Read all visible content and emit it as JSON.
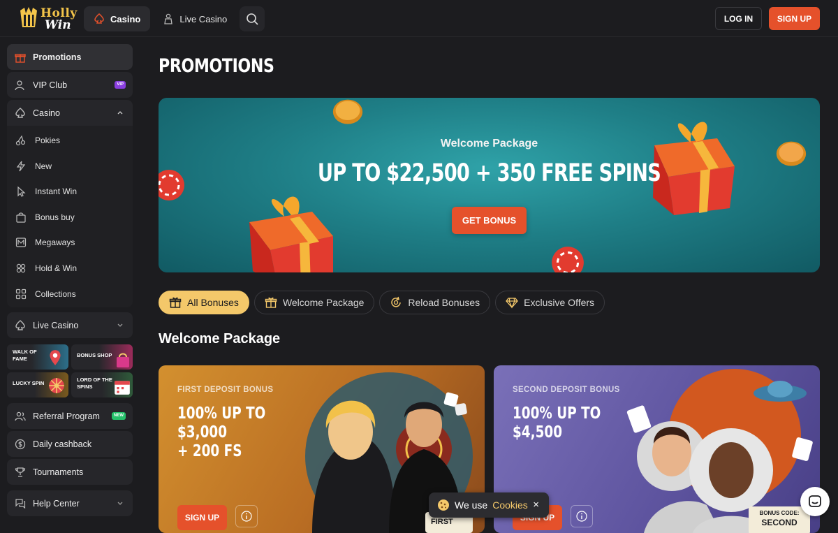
{
  "brand": {
    "line1": "Holly",
    "line2": "Win"
  },
  "topnav": {
    "casino": "Casino",
    "live_casino": "Live Casino",
    "login": "LOG IN",
    "signup": "SIGN UP"
  },
  "sidebar": {
    "promotions": "Promotions",
    "vip": {
      "label": "VIP Club",
      "badge": "VIP"
    },
    "casino": "Casino",
    "casino_items": [
      "Pokies",
      "New",
      "Instant Win",
      "Bonus buy",
      "Megaways",
      "Hold & Win",
      "Collections"
    ],
    "live_casino": "Live Casino",
    "tiles": [
      "WALK OF FAME",
      "BONUS SHOP",
      "LUCKY SPIN",
      "LORD OF THE SPINS"
    ],
    "referral": {
      "label": "Referral Program",
      "badge": "NEW"
    },
    "cashback": "Daily cashback",
    "tournaments": "Tournaments",
    "help": "Help Center"
  },
  "page": {
    "title": "PROMOTIONS"
  },
  "hero": {
    "subtitle": "Welcome Package",
    "headline": "UP TO $22,500 + 350 FREE SPINS",
    "cta": "GET BONUS"
  },
  "filters": [
    "All Bonuses",
    "Welcome Package",
    "Reload Bonuses",
    "Exclusive Offers"
  ],
  "section_title": "Welcome Package",
  "cards": [
    {
      "label": "FIRST DEPOSIT BONUS",
      "amount_lines": [
        "100% UP TO",
        "$3,000",
        "+ 200 FS"
      ],
      "cta": "SIGN UP",
      "ticket": "FIRST"
    },
    {
      "label": "SECOND DEPOSIT BONUS",
      "amount_lines": [
        "100% UP TO",
        "$4,500"
      ],
      "cta": "SIGN UP",
      "code_label": "BONUS CODE:",
      "code": "SECOND"
    }
  ],
  "cookie": {
    "prefix": "We use",
    "link": "Cookies",
    "close": "×"
  },
  "colors": {
    "accent": "#e5512b",
    "gold": "#f4c86a",
    "bg": "#1c1c1f",
    "panel": "#26262a"
  }
}
